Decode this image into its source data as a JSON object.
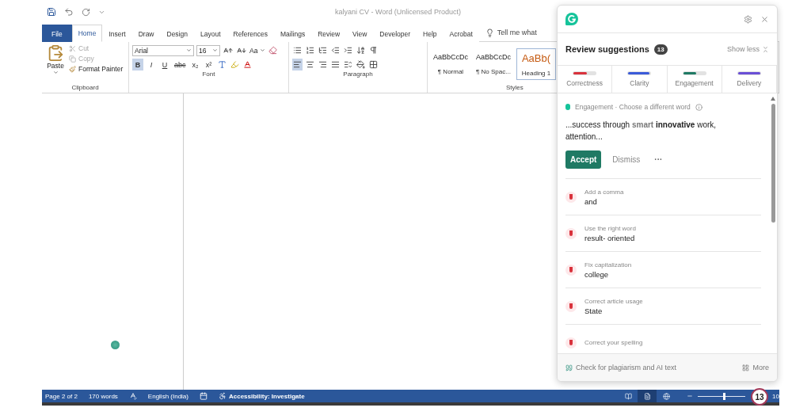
{
  "window": {
    "title": "kalyani CV  -  Word (Unlicensed Product)"
  },
  "tabs": [
    {
      "label": "File",
      "selected": false,
      "kind": "file"
    },
    {
      "label": "Home",
      "selected": true,
      "kind": "tab"
    },
    {
      "label": "Insert",
      "selected": false,
      "kind": "tab"
    },
    {
      "label": "Draw",
      "selected": false,
      "kind": "tab"
    },
    {
      "label": "Design",
      "selected": false,
      "kind": "tab"
    },
    {
      "label": "Layout",
      "selected": false,
      "kind": "tab"
    },
    {
      "label": "References",
      "selected": false,
      "kind": "tab"
    },
    {
      "label": "Mailings",
      "selected": false,
      "kind": "tab"
    },
    {
      "label": "Review",
      "selected": false,
      "kind": "tab"
    },
    {
      "label": "View",
      "selected": false,
      "kind": "tab"
    },
    {
      "label": "Developer",
      "selected": false,
      "kind": "tab"
    },
    {
      "label": "Help",
      "selected": false,
      "kind": "tab"
    },
    {
      "label": "Acrobat",
      "selected": false,
      "kind": "tab"
    }
  ],
  "tell_me": {
    "placeholder": "Tell me what"
  },
  "clipboard": {
    "label": "Clipboard",
    "paste": "Paste",
    "cut": {
      "label": "Cut",
      "disabled": true
    },
    "copy": {
      "label": "Copy",
      "disabled": true
    },
    "format_painter": {
      "label": "Format Painter",
      "disabled": false
    }
  },
  "font": {
    "label": "Font",
    "font_name": "Arial",
    "font_size": "16",
    "change_case": "Aa",
    "format_buttons": [
      {
        "label": "B",
        "selected": true,
        "kind": "bold"
      },
      {
        "label": "I",
        "selected": false,
        "kind": "italic"
      },
      {
        "label": "U",
        "selected": false,
        "kind": "underline"
      },
      {
        "label": "abc",
        "selected": false,
        "kind": "strike"
      },
      {
        "label": "x₂",
        "selected": false,
        "kind": "plain"
      },
      {
        "label": "x²",
        "selected": false,
        "kind": "plain"
      }
    ]
  },
  "paragraph": {
    "label": "Paragraph",
    "alignments": [
      {
        "kind": "left",
        "selected": true
      },
      {
        "kind": "center",
        "selected": false
      },
      {
        "kind": "right",
        "selected": false
      },
      {
        "kind": "justify",
        "selected": false
      }
    ]
  },
  "styles": {
    "label": "Styles",
    "items": [
      {
        "sample": "AaBbCcDc",
        "name": "¶ Normal",
        "kind": "body",
        "selected": false
      },
      {
        "sample": "AaBbCcDc",
        "name": "¶ No Spac...",
        "kind": "body",
        "selected": false
      },
      {
        "sample": "AaBb(",
        "name": "Heading 1",
        "kind": "heading",
        "selected": true
      }
    ]
  },
  "status_bar": {
    "page": "Page 2 of 2",
    "words": "170 words",
    "language": "English (India)",
    "accessibility": "Accessibility: Investigate",
    "views": [
      {
        "kind": "read",
        "selected": false
      },
      {
        "kind": "print",
        "selected": true
      },
      {
        "kind": "web",
        "selected": false
      }
    ],
    "zoom": {
      "level": 0.55,
      "reading": "10"
    }
  },
  "grammarly": {
    "title": "Review suggestions",
    "count": "13",
    "show_less": "Show less",
    "categories": [
      {
        "label": "Correctness",
        "color": "#d9323c",
        "level": 0.6
      },
      {
        "label": "Clarity",
        "color": "#3b5bd9",
        "level": 0.95
      },
      {
        "label": "Engagement",
        "color": "#1f7a64",
        "level": 0.6
      },
      {
        "label": "Delivery",
        "color": "#6a4fd6",
        "level": 1
      }
    ],
    "featured": {
      "category": "Engagement · Choose a different word",
      "before": "...success through ",
      "removed": "smart",
      "inserted": "innovative",
      "after": " work, attention...",
      "accept": "Accept",
      "dismiss": "Dismiss",
      "more": "···"
    },
    "suggestions": [
      {
        "title": "Add a comma",
        "text": "and"
      },
      {
        "title": "Use the right word",
        "text": "result- oriented"
      },
      {
        "title": "Fix capitalization",
        "text": "college"
      },
      {
        "title": "Correct article usage",
        "text": "State"
      },
      {
        "title": "Correct your spelling"
      }
    ],
    "footer": {
      "plagiarism": "Check for plagiarism and AI text",
      "more": "More"
    },
    "badge": "13"
  }
}
